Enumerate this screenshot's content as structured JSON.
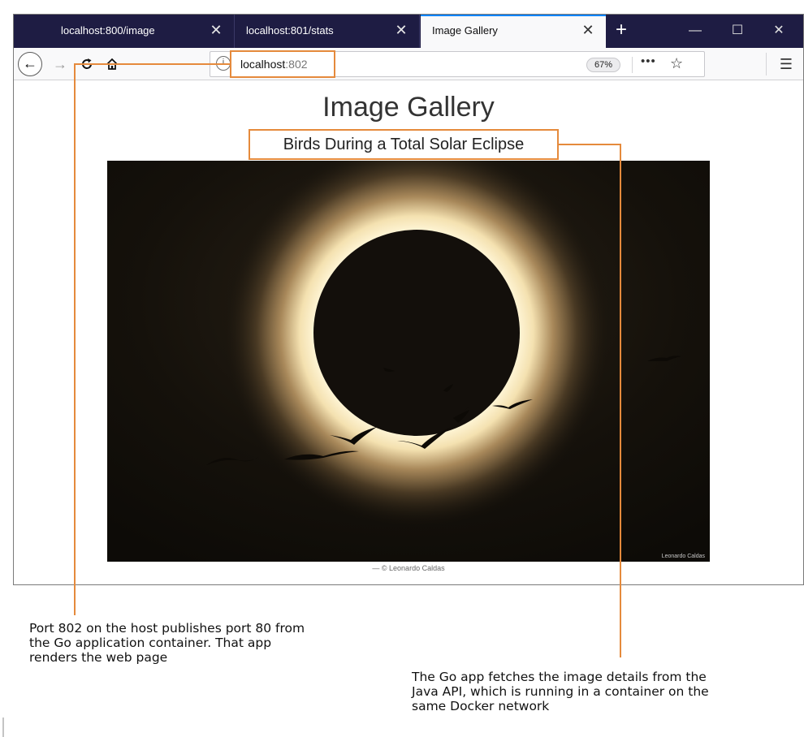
{
  "browser": {
    "tabs": [
      {
        "label": "localhost:800/image",
        "active": false
      },
      {
        "label": "localhost:801/stats",
        "active": false
      },
      {
        "label": "Image Gallery",
        "active": true
      }
    ],
    "tab_close_glyph": "✕",
    "new_tab_glyph": "+",
    "window_controls": [
      "—",
      "☐",
      "✕"
    ],
    "url": {
      "host": "localhost",
      "port": ":802"
    },
    "zoom": "67%",
    "more_glyph": "•••",
    "star_glyph": "☆",
    "menu_glyph": "☰"
  },
  "page": {
    "title": "Image Gallery",
    "caption": "Birds During a Total Solar Eclipse",
    "image_watermark": "Leonardo Caldas",
    "credit": "— © Leonardo Caldas"
  },
  "annotations": {
    "port_note": "Port 802 on the host publishes port 80 from\nthe Go application container. That app\nrenders the web page",
    "api_note": "The Go app fetches the image details from the\nJava API, which is running in a container on the\nsame Docker network",
    "line_color": "#e58a3c"
  }
}
